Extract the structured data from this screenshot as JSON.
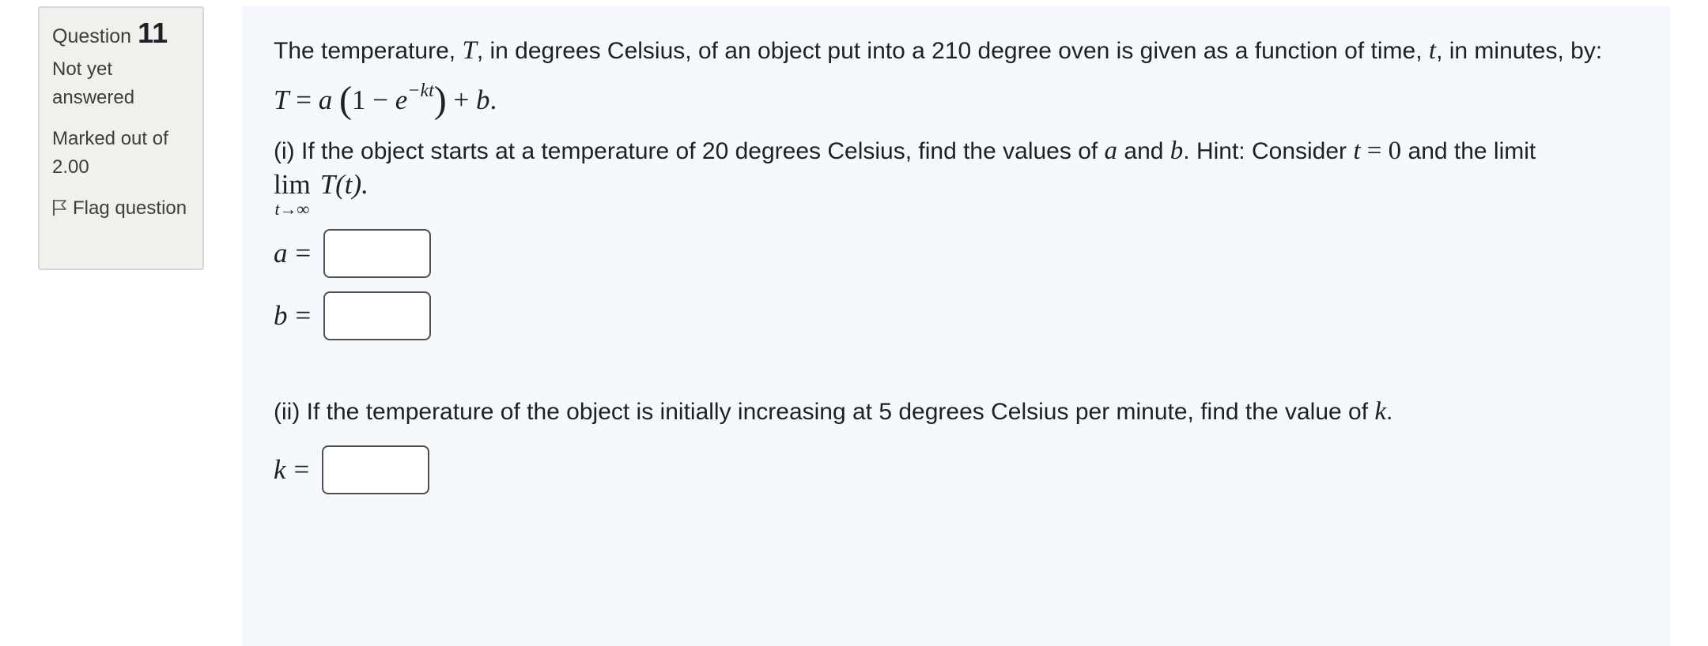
{
  "info": {
    "question_label": "Question",
    "question_number": "11",
    "state": "Not yet answered",
    "grade": "Marked out of 2.00",
    "flag_label": "Flag question"
  },
  "question": {
    "intro_part1": "The temperature, ",
    "intro_var_T": "T",
    "intro_part2": ", in degrees Celsius, of an object put into a 210 degree oven is given as a function of time, ",
    "intro_var_t": "t",
    "intro_part3": ", in minutes, by:",
    "formula": {
      "lhs": "T",
      "equals": " = ",
      "a": "a",
      "open_paren": "(",
      "one_minus": "1 − ",
      "e": "e",
      "exponent": "−kt",
      "close_paren": ")",
      "plus": " + ",
      "b": "b",
      "period": "."
    },
    "part1": {
      "text1": "(i) If the object starts at a temperature of 20 degrees Celsius, find the values of ",
      "var_a": "a",
      "text2": " and ",
      "var_b": "b",
      "text3": ". Hint: Consider ",
      "var_t": "t",
      "eq_zero": " = 0",
      "text4": " and the limit",
      "lim": "lim",
      "lim_sub": "t→∞",
      "lim_expr": "T(t)."
    },
    "answers": {
      "a_label": "a",
      "b_label": "b",
      "k_label": "k",
      "equals": "=",
      "a_value": "",
      "b_value": "",
      "k_value": ""
    },
    "part2": {
      "text1": "(ii) If the temperature of the object is initially increasing at 5 degrees Celsius per minute, find the value of ",
      "var_k": "k",
      "text2": "."
    }
  }
}
